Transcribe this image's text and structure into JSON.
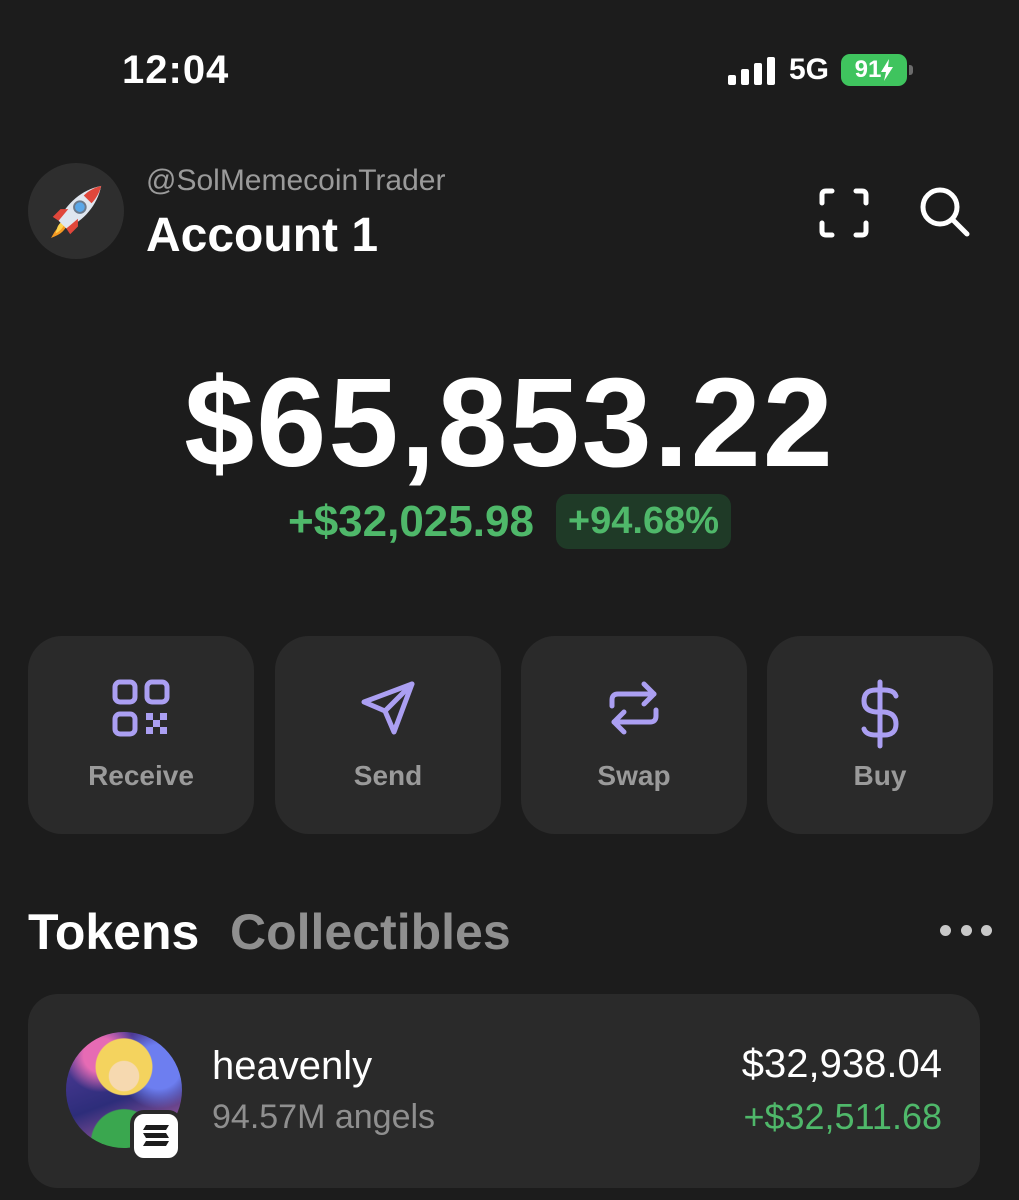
{
  "status_bar": {
    "time": "12:04",
    "network": "5G",
    "battery": "91",
    "battery_color": "#3fc45e"
  },
  "header": {
    "avatar_icon": "rocket-icon",
    "handle": "@SolMemecoinTrader",
    "account_name": "Account 1",
    "scan_icon": "scan-icon",
    "search_icon": "search-icon"
  },
  "balance": {
    "total": "$65,853.22",
    "change_amount": "+$32,025.98",
    "change_percent": "+94.68%",
    "positive_color": "#4fb86a"
  },
  "actions": [
    {
      "label": "Receive",
      "icon": "qr-code-icon"
    },
    {
      "label": "Send",
      "icon": "send-icon"
    },
    {
      "label": "Swap",
      "icon": "swap-icon"
    },
    {
      "label": "Buy",
      "icon": "dollar-icon"
    }
  ],
  "accent_color": "#ab9ff2",
  "tabs": {
    "tokens": "Tokens",
    "collectibles": "Collectibles",
    "active": "Tokens"
  },
  "tokens": [
    {
      "name": "heavenly",
      "amount": "94.57M angels",
      "value": "$32,938.04",
      "change": "+$32,511.68",
      "chain_icon": "solana-icon"
    }
  ]
}
